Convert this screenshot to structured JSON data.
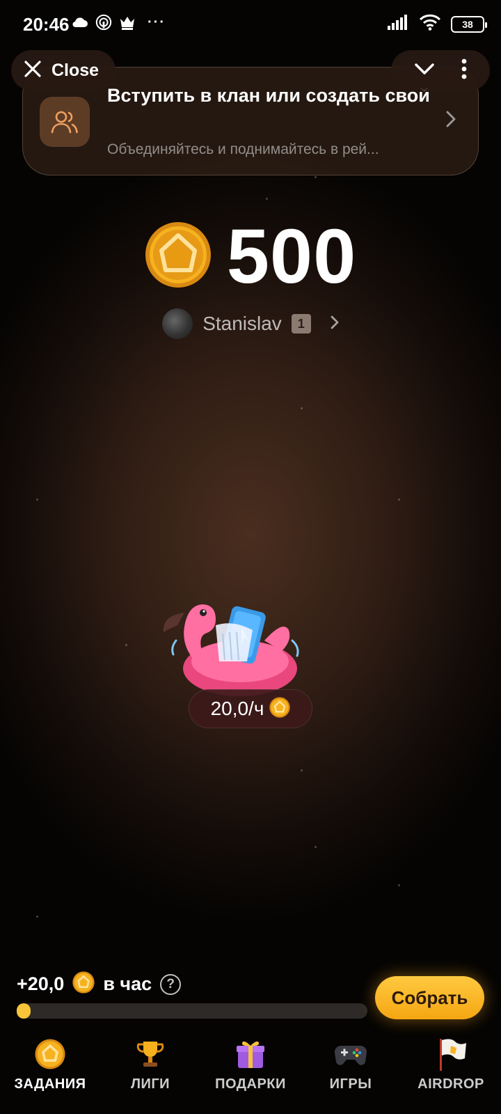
{
  "status_bar": {
    "time": "20:46",
    "battery": "38",
    "more": "···"
  },
  "top_bar": {
    "close_label": "Close"
  },
  "clan_card": {
    "title": "Вступить в клан или создать свой",
    "subtitle": "Объединяйтесь и поднимайтесь в рей..."
  },
  "balance": {
    "value": "500"
  },
  "user": {
    "name": "Stanislav",
    "level": "1"
  },
  "earning": {
    "rate_label": "20,0/ч"
  },
  "income": {
    "value": "+20,0",
    "unit": "в час",
    "help": "?",
    "progress_fraction": 0.04
  },
  "collect_button": "Собрать",
  "nav": [
    {
      "label": "ЗАДАНИЯ",
      "icon": "coin-icon"
    },
    {
      "label": "ЛИГИ",
      "icon": "trophy-icon"
    },
    {
      "label": "ПОДАРКИ",
      "icon": "gift-icon"
    },
    {
      "label": "ИГРЫ",
      "icon": "gamepad-icon"
    },
    {
      "label": "AIRDROP",
      "icon": "flag-icon"
    }
  ],
  "colors": {
    "accent": "#f8c53a",
    "button": "#ffb21f",
    "background": "#1a100b"
  }
}
